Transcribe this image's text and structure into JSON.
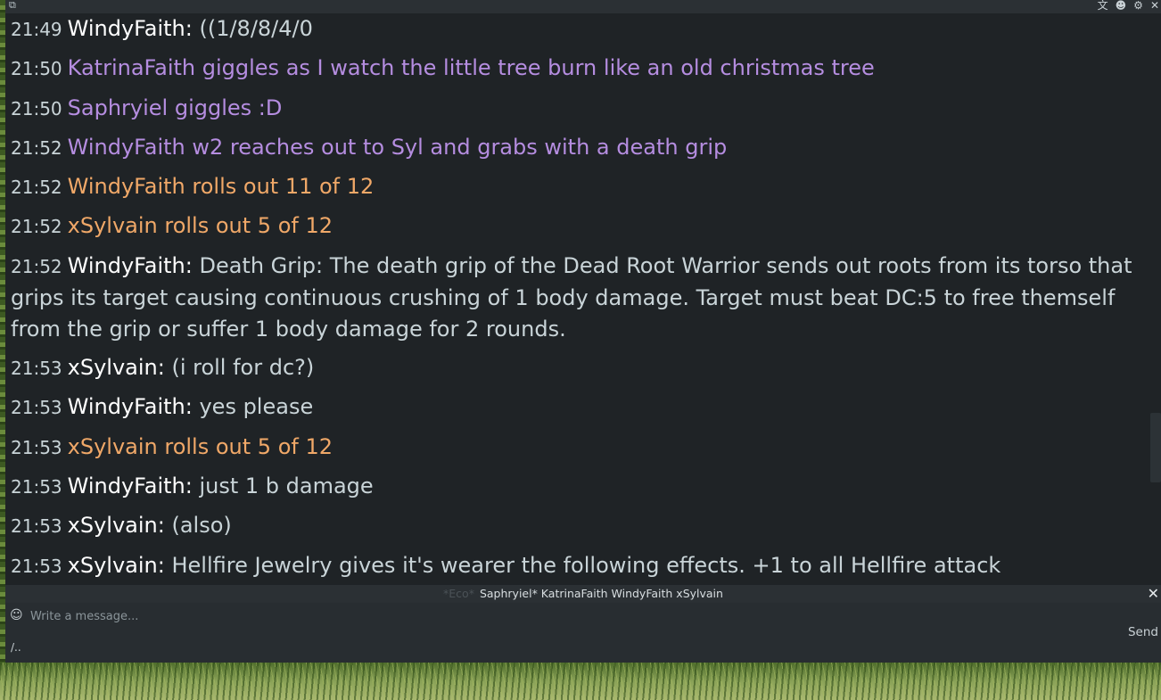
{
  "window": {
    "title_icon": "window-restore-icon",
    "controls": [
      {
        "name": "translate-icon",
        "glyph": "文"
      },
      {
        "name": "chat-bubble-icon",
        "glyph": "☻"
      },
      {
        "name": "gear-icon",
        "glyph": "⚙"
      },
      {
        "name": "close-icon",
        "glyph": "✕"
      }
    ]
  },
  "messages": [
    {
      "time": "21:49",
      "kind": "say",
      "name": "WindyFaith:",
      "text": " ((1/8/8/4/0"
    },
    {
      "time": "21:50",
      "kind": "emote",
      "name": "",
      "text": "KatrinaFaith giggles as I watch the little tree burn like an old christmas tree"
    },
    {
      "time": "21:50",
      "kind": "emote",
      "name": "",
      "text": "Saphryiel giggles :D"
    },
    {
      "time": "21:52",
      "kind": "emote",
      "name": "",
      "text": "WindyFaith w2 reaches out to Syl and grabs with a death grip"
    },
    {
      "time": "21:52",
      "kind": "roll",
      "name": "",
      "text": "WindyFaith rolls out 11 of 12"
    },
    {
      "time": "21:52",
      "kind": "roll",
      "name": "",
      "text": "xSylvain rolls out 5 of 12"
    },
    {
      "time": "21:52",
      "kind": "say",
      "name": "WindyFaith:",
      "text": " Death Grip: The death grip of the Dead Root Warrior sends out roots from its torso that grips its target causing continuous crushing of 1 body damage. Target must beat DC:5 to free themself from the grip or suffer 1 body damage for 2 rounds."
    },
    {
      "time": "21:53",
      "kind": "say",
      "name": "xSylvain:",
      "text": " (i roll for dc?)"
    },
    {
      "time": "21:53",
      "kind": "say",
      "name": "WindyFaith:",
      "text": " yes please"
    },
    {
      "time": "21:53",
      "kind": "roll",
      "name": "",
      "text": "xSylvain rolls out 5 of 12"
    },
    {
      "time": "21:53",
      "kind": "say",
      "name": "WindyFaith:",
      "text": " just 1 b damage"
    },
    {
      "time": "21:53",
      "kind": "say",
      "name": "xSylvain:",
      "text": " (also)"
    },
    {
      "time": "21:53",
      "kind": "say",
      "name": "xSylvain:",
      "text": " Hellfire Jewelry gives it's wearer the following effects. +1 to all Hellfire attack"
    }
  ],
  "typing_bar": {
    "channel": "*Eco*",
    "participants": "Saphryiel* KatrinaFaith WindyFaith xSylvain"
  },
  "composer": {
    "placeholder": "Write a message...",
    "value": "",
    "send_label": "Send",
    "command_hint": "/.."
  },
  "colors": {
    "emote": "#b58de0",
    "roll": "#f0a868",
    "name": "#ffffff",
    "text": "#c9d4d8",
    "background": "#1f2326"
  }
}
